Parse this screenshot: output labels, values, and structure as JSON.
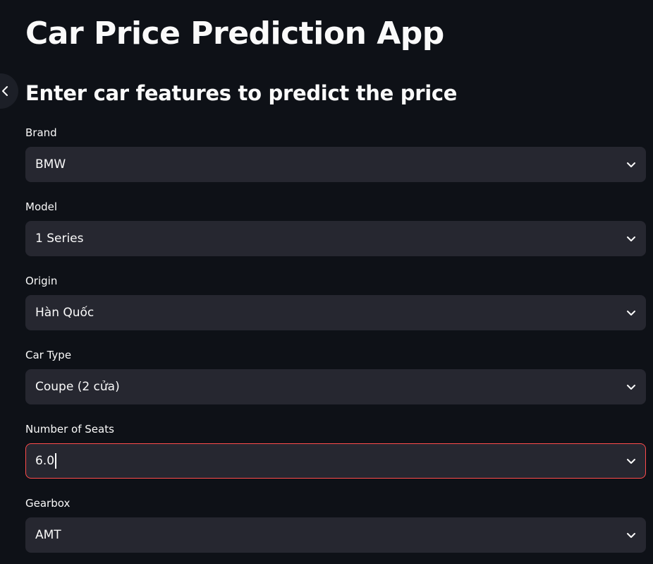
{
  "app": {
    "title": "Car Price Prediction App",
    "subtitle": "Enter car features to predict the price"
  },
  "sidebar_toggle": {
    "icon": "sidebar-collapse-icon"
  },
  "form": {
    "fields": [
      {
        "label": "Brand",
        "value": "BMW",
        "icon": "chevron-down-icon"
      },
      {
        "label": "Model",
        "value": "1 Series",
        "icon": "chevron-down-icon"
      },
      {
        "label": "Origin",
        "value": "Hàn Quốc",
        "icon": "chevron-down-icon"
      },
      {
        "label": "Car Type",
        "value": "Coupe (2 cửa)",
        "icon": "chevron-down-icon"
      },
      {
        "label": "Number of Seats",
        "value": "6.0",
        "icon": "chevron-down-icon",
        "focused": true
      },
      {
        "label": "Gearbox",
        "value": "AMT",
        "icon": "chevron-down-icon"
      }
    ]
  },
  "colors": {
    "background": "#0e1117",
    "input_background": "#262730",
    "text": "#fafafa",
    "focus_border": "#ff4b4b"
  }
}
